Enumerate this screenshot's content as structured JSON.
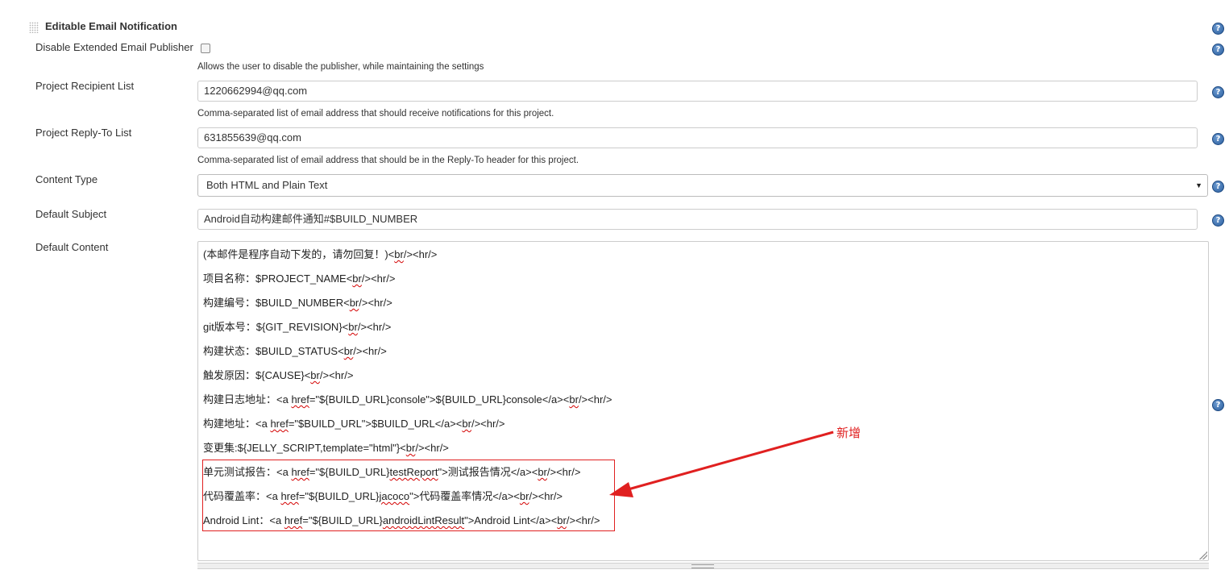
{
  "section": {
    "title": "Editable Email Notification",
    "help_glyph": "?"
  },
  "disable_publisher": {
    "label": "Disable Extended Email Publisher",
    "checked": false,
    "description": "Allows the user to disable the publisher, while maintaining the settings"
  },
  "recipient_list": {
    "label": "Project Recipient List",
    "value": "1220662994@qq.com",
    "description": "Comma-separated list of email address that should receive notifications for this project."
  },
  "reply_to": {
    "label": "Project Reply-To List",
    "value": "631855639@qq.com",
    "description": "Comma-separated list of email address that should be in the Reply-To header for this project."
  },
  "content_type": {
    "label": "Content Type",
    "selected": "Both HTML and Plain Text"
  },
  "default_subject": {
    "label": "Default Subject",
    "value": "Android自动构建邮件通知#$BUILD_NUMBER"
  },
  "default_content": {
    "label": "Default Content",
    "lines": [
      [
        {
          "t": "(本邮件是程序自动下发的，请勿回复！)<"
        },
        {
          "t": "br",
          "s": true
        },
        {
          "t": "/><hr/>"
        }
      ],
      [
        {
          "t": "项目名称：$PROJECT_NAME<"
        },
        {
          "t": "br",
          "s": true
        },
        {
          "t": "/><hr/>"
        }
      ],
      [
        {
          "t": "构建编号：$BUILD_NUMBER<"
        },
        {
          "t": "br",
          "s": true
        },
        {
          "t": "/><hr/>"
        }
      ],
      [
        {
          "t": "git版本号：${GIT_REVISION}<"
        },
        {
          "t": "br",
          "s": true
        },
        {
          "t": "/><hr/>"
        }
      ],
      [
        {
          "t": "构建状态：$BUILD_STATUS<"
        },
        {
          "t": "br",
          "s": true
        },
        {
          "t": "/><hr/>"
        }
      ],
      [
        {
          "t": "触发原因：${CAUSE}<"
        },
        {
          "t": "br",
          "s": true
        },
        {
          "t": "/><hr/>"
        }
      ],
      [
        {
          "t": "构建日志地址：<a "
        },
        {
          "t": "href",
          "s": true
        },
        {
          "t": "=\"${BUILD_URL}console\">${BUILD_URL}console</a><"
        },
        {
          "t": "br",
          "s": true
        },
        {
          "t": "/><hr/>"
        }
      ],
      [
        {
          "t": "构建地址：<a "
        },
        {
          "t": "href",
          "s": true
        },
        {
          "t": "=\"$BUILD_URL\">$BUILD_URL</a><"
        },
        {
          "t": "br",
          "s": true
        },
        {
          "t": "/><hr/>"
        }
      ],
      [
        {
          "t": "变更集:${JELLY_SCRIPT,template=\"html\"}<"
        },
        {
          "t": "br",
          "s": true
        },
        {
          "t": "/><hr/>"
        }
      ],
      [
        {
          "t": "单元测试报告：<a "
        },
        {
          "t": "href",
          "s": true
        },
        {
          "t": "=\"${BUILD_URL}"
        },
        {
          "t": "testReport",
          "s": true
        },
        {
          "t": "\">测试报告情况</a><"
        },
        {
          "t": "br",
          "s": true
        },
        {
          "t": "/><hr/>"
        }
      ],
      [
        {
          "t": "代码覆盖率：<a "
        },
        {
          "t": "href",
          "s": true
        },
        {
          "t": "=\"${BUILD_URL}"
        },
        {
          "t": "jacoco",
          "s": true
        },
        {
          "t": "\">代码覆盖率情况</a><"
        },
        {
          "t": "br",
          "s": true
        },
        {
          "t": "/><hr/>"
        }
      ],
      [
        {
          "t": "Android Lint：<a "
        },
        {
          "t": "href",
          "s": true
        },
        {
          "t": "=\"${BUILD_URL}"
        },
        {
          "t": "androidLintResult",
          "s": true
        },
        {
          "t": "\">Android Lint</a><"
        },
        {
          "t": "br",
          "s": true
        },
        {
          "t": "/><hr/>"
        }
      ]
    ]
  },
  "annotation": {
    "text": "新增",
    "color": "#e02020"
  }
}
